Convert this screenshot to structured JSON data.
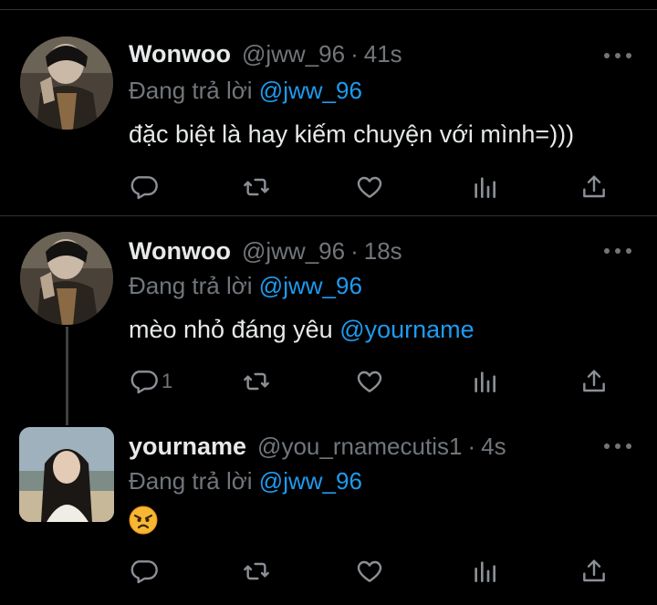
{
  "tweets": [
    {
      "name": "Wonwoo",
      "handle": "@jww_96",
      "separator": "·",
      "time": "41s",
      "reply_prefix": "Đang trả lời",
      "reply_to": "@jww_96",
      "text": "đặc biệt là hay kiếm chuyện với mình=)))",
      "reply_count": ""
    },
    {
      "name": "Wonwoo",
      "handle": "@jww_96",
      "separator": "·",
      "time": "18s",
      "reply_prefix": "Đang trả lời",
      "reply_to": "@jww_96",
      "text": "mèo nhỏ đáng yêu",
      "text_mention": "@yourname",
      "reply_count": "1"
    },
    {
      "name": "yourname",
      "handle": "@you_rnamecutis1",
      "separator": "·",
      "time": "4s",
      "reply_prefix": "Đang trả lời",
      "reply_to": "@jww_96",
      "emoji": "angry-face-emoji",
      "reply_count": ""
    }
  ],
  "icons": {
    "reply": "speech-bubble-icon",
    "retweet": "retweet-icon",
    "like": "heart-icon",
    "analytics": "bar-chart-icon",
    "share": "share-upload-icon",
    "more": "more-dots-icon"
  },
  "colors": {
    "background": "#000000",
    "text": "#e7e9ea",
    "muted": "#71767b",
    "mention": "#1d9bf0",
    "divider": "#2f3336"
  }
}
